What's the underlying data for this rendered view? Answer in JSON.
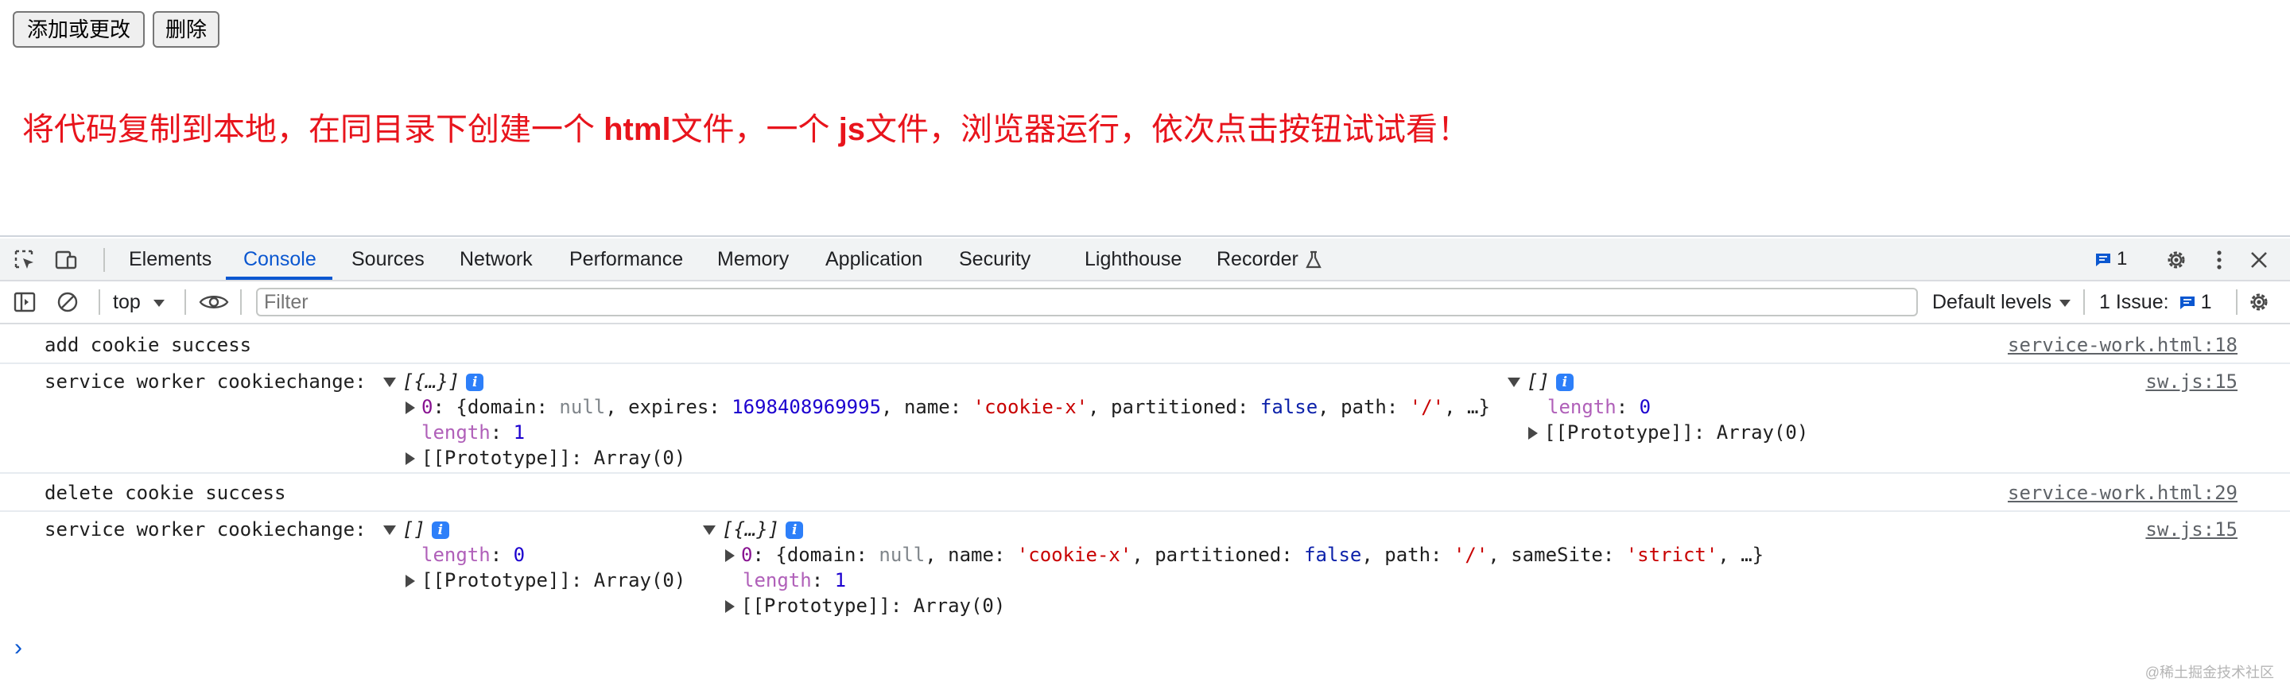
{
  "page": {
    "add_button": "添加或更改",
    "delete_button": "删除",
    "message": {
      "part1": "将代码复制到本地，在同目录下创建一个 ",
      "bold1": "html",
      "part2": "文件，一个 ",
      "bold2": "js",
      "part3": "文件，浏览器运行，依次点击按钮试试看！"
    },
    "accent_color": "#e8141c"
  },
  "devtools": {
    "tabs": [
      "Elements",
      "Console",
      "Sources",
      "Network",
      "Performance",
      "Memory",
      "Application",
      "Security",
      "Lighthouse",
      "Recorder"
    ],
    "active_tab": "Console",
    "message_badge": "1",
    "toolbar": {
      "context": "top",
      "filter_placeholder": "Filter",
      "levels": "Default levels",
      "issues_label": "1 Issue:",
      "issues_count": "1"
    },
    "console": {
      "r1_text": "add cookie success",
      "r1_src": "service-work.html:18",
      "r2_label": "service worker cookiechange:",
      "r2_a_head": "[{…}]",
      "r2_a_item_key": "0",
      "r2_a_item_domain_key": "domain",
      "r2_a_item_domain": "null",
      "r2_a_item_expires_key": "expires",
      "r2_a_item_expires": "1698408969995",
      "r2_a_item_name_key": "name",
      "r2_a_item_name": "'cookie-x'",
      "r2_a_item_part_key": "partitioned",
      "r2_a_item_part": "false",
      "r2_a_item_path_key": "path",
      "r2_a_item_path": "'/'",
      "length_key": "length",
      "r2_a_length": "1",
      "proto": "[[Prototype]]: Array(0)",
      "r2_b_head": "[]",
      "r2_b_length": "0",
      "r2_src": "sw.js:15",
      "r3_text": "delete cookie success",
      "r3_src": "service-work.html:29",
      "r4_label": "service worker cookiechange:",
      "r4_a_head": "[]",
      "r4_a_length": "0",
      "r4_b_head": "[{…}]",
      "r4_b_item_key": "0",
      "r4_b_item_domain": "null",
      "r4_b_item_name": "'cookie-x'",
      "r4_b_item_part": "false",
      "r4_b_item_path": "'/'",
      "r4_b_item_samesite_key": "sameSite",
      "r4_b_item_samesite": "'strict'",
      "r4_b_length": "1",
      "r4_src": "sw.js:15"
    }
  },
  "watermark": "@稀土掘金技术社区"
}
